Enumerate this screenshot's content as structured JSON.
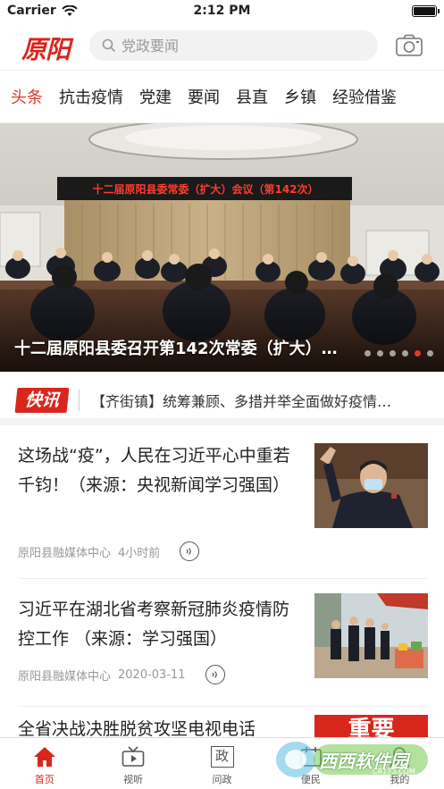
{
  "status_bar": {
    "carrier": "Carrier",
    "time": "2:12 PM"
  },
  "header": {
    "logo": "原阳",
    "search_placeholder": "党政要闻"
  },
  "tabs": [
    {
      "label": "头条",
      "active": true
    },
    {
      "label": "抗击疫情"
    },
    {
      "label": "党建"
    },
    {
      "label": "要闻"
    },
    {
      "label": "县直"
    },
    {
      "label": "乡镇"
    },
    {
      "label": "经验借鉴"
    }
  ],
  "banner": {
    "screen_text": "十二届原阳县委常委（扩大）会议（第142次）",
    "caption": "十二届原阳县委召开第142次常委（扩大）…"
  },
  "flash": {
    "badge": "快讯",
    "text": "【齐街镇】统筹兼顾、多措并举全面做好疫情…"
  },
  "news": [
    {
      "title": "这场战“疫”，人民在习近平心中重若千钧！（来源：央视新闻学习强国）",
      "source": "原阳县融媒体中心",
      "time": "4小时前"
    },
    {
      "title": "习近平在湖北省考察新冠肺炎疫情防控工作 （来源：学习强国）",
      "source": "原阳县融媒体中心",
      "time": "2020-03-11"
    },
    {
      "title": "全省决战决胜脱贫攻坚电视电话",
      "thumb_text": "重要"
    }
  ],
  "bottom_nav": [
    {
      "label": "首页",
      "icon": "home-icon",
      "active": true
    },
    {
      "label": "视听",
      "icon": "tv-icon"
    },
    {
      "label": "问政",
      "icon": "policy-icon",
      "glyph": "政"
    },
    {
      "label": "便民",
      "icon": "service-icon"
    },
    {
      "label": "我的",
      "icon": "user-icon"
    }
  ],
  "watermark": {
    "text": "西西软件园",
    "sub": "CR173.COM"
  },
  "colors": {
    "brand": "#d9261c",
    "tab_active": "#e0392b"
  }
}
